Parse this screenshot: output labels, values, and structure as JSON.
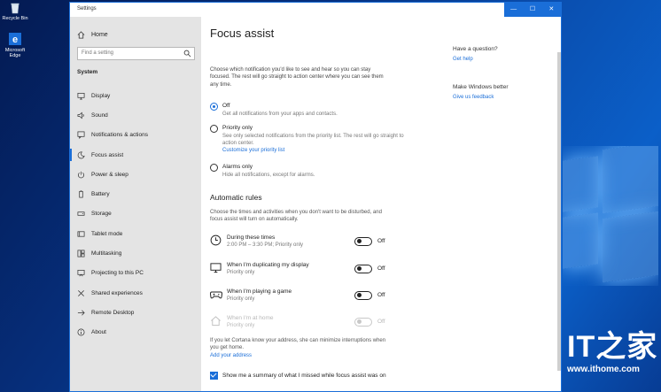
{
  "desktop": {
    "icons": [
      {
        "label": "Recycle Bin",
        "icon": "recycle-bin-icon"
      },
      {
        "label": "Microsoft Edge",
        "icon": "edge-icon"
      }
    ],
    "watermark": {
      "brand": "IT之家",
      "url": "www.ithome.com"
    }
  },
  "window": {
    "title": "Settings",
    "controls": {
      "minimize": "—",
      "maximize": "☐",
      "close": "✕"
    },
    "accent": "#1a6ed8"
  },
  "sidebar": {
    "home_label": "Home",
    "search_placeholder": "Find a setting",
    "section": "System",
    "items": [
      {
        "label": "Display",
        "icon": "display-icon"
      },
      {
        "label": "Sound",
        "icon": "sound-icon"
      },
      {
        "label": "Notifications & actions",
        "icon": "notifications-icon"
      },
      {
        "label": "Focus assist",
        "icon": "moon-icon",
        "active": true
      },
      {
        "label": "Power & sleep",
        "icon": "power-icon"
      },
      {
        "label": "Battery",
        "icon": "battery-icon"
      },
      {
        "label": "Storage",
        "icon": "storage-icon"
      },
      {
        "label": "Tablet mode",
        "icon": "tablet-icon"
      },
      {
        "label": "Multitasking",
        "icon": "multitasking-icon"
      },
      {
        "label": "Projecting to this PC",
        "icon": "projecting-icon"
      },
      {
        "label": "Shared experiences",
        "icon": "shared-icon"
      },
      {
        "label": "Remote Desktop",
        "icon": "remote-icon"
      },
      {
        "label": "About",
        "icon": "info-icon"
      }
    ]
  },
  "main": {
    "title": "Focus assist",
    "intro": "Choose which notification you'd like to see and hear so you can stay focused. The rest will go straight to action center where you can see them any time.",
    "options": [
      {
        "label": "Off",
        "desc": "Get all notifications from your apps and contacts.",
        "selected": true
      },
      {
        "label": "Priority only",
        "desc": "See only selected notifications from the priority list. The rest will go straight to action center.",
        "link": "Customize your priority list"
      },
      {
        "label": "Alarms only",
        "desc": "Hide all notifications, except for alarms."
      }
    ],
    "rules_heading": "Automatic rules",
    "rules_desc": "Choose the times and activities when you don't want to be disturbed, and focus assist will turn on automatically.",
    "rules": [
      {
        "name": "During these times",
        "sub": "2:00 PM – 3:30 PM; Priority only",
        "state": "Off",
        "icon": "clock-icon"
      },
      {
        "name": "When I'm duplicating my display",
        "sub": "Priority only",
        "state": "Off",
        "icon": "monitor-icon"
      },
      {
        "name": "When I'm playing a game",
        "sub": "Priority only",
        "state": "Off",
        "icon": "gamepad-icon"
      },
      {
        "name": "When I'm at home",
        "sub": "Priority only",
        "state": "Off",
        "icon": "home-icon",
        "disabled": true
      }
    ],
    "cortana_text": "If you let Cortana know your address, she can minimize interruptions when you get home.",
    "cortana_link": "Add your address",
    "summary_checkbox": "Show me a summary of what I missed while focus assist was on",
    "summary_checked": true
  },
  "right": {
    "question": "Have a question?",
    "help_link": "Get help",
    "improve": "Make Windows better",
    "feedback_link": "Give us feedback"
  }
}
